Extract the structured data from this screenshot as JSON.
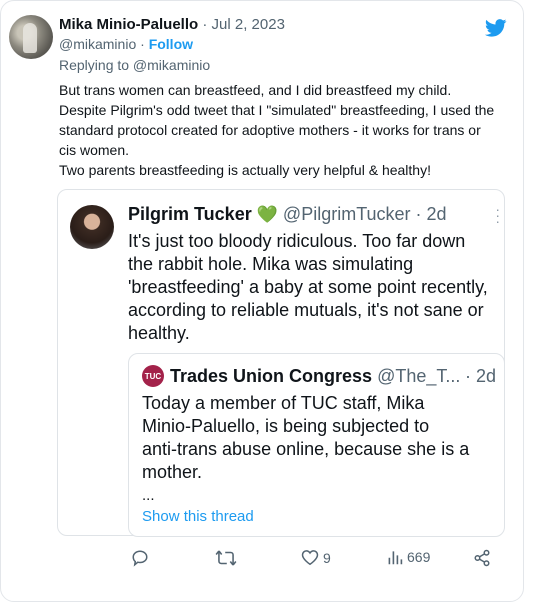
{
  "tweet": {
    "author_name": "Mika Minio-Paluello",
    "separator": "·",
    "date": "Jul 2, 2023",
    "handle": "@mikaminio",
    "follow_label": "Follow",
    "reply_label": "Replying to @mikaminio",
    "body_lines": [
      "But trans women can breastfeed, and I did breastfeed my child.",
      "Despite Pilgrim's odd tweet that I \"simulated\" breastfeeding, I used the",
      "standard protocol created for adoptive mothers - it works for trans or",
      "cis women.",
      "Two parents breastfeeding is actually very helpful & healthy!"
    ],
    "brand_icon": "twitter-bird-icon",
    "colors": {
      "accent": "#1d9bf0",
      "muted": "#536471",
      "heart": "#5fc33c"
    }
  },
  "quote": {
    "name": "Pilgrim Tucker",
    "heart": "💚",
    "handle_time": "@PilgrimTucker · 2d",
    "body_lines": [
      "It's just too bloody ridiculous. Too far down",
      "the rabbit hole. Mika was simulating",
      "'breastfeeding' a baby at some point recently,",
      "according to reliable mutuals, it's not sane or",
      "healthy."
    ]
  },
  "nested_quote": {
    "logo_text": "TUC",
    "name": "Trades Union Congress",
    "handle": "@The_T...",
    "time": "· 2d",
    "body_lines": [
      "Today a member of TUC staff, Mika",
      "Minio-Paluello, is being subjected to",
      "anti-trans abuse online, because she is a",
      "mother."
    ],
    "ellipsis": "...",
    "show_thread": "Show this thread"
  },
  "actions": {
    "reply_count": "",
    "retweet_count": "",
    "like_count": "9",
    "views_count": "669"
  }
}
